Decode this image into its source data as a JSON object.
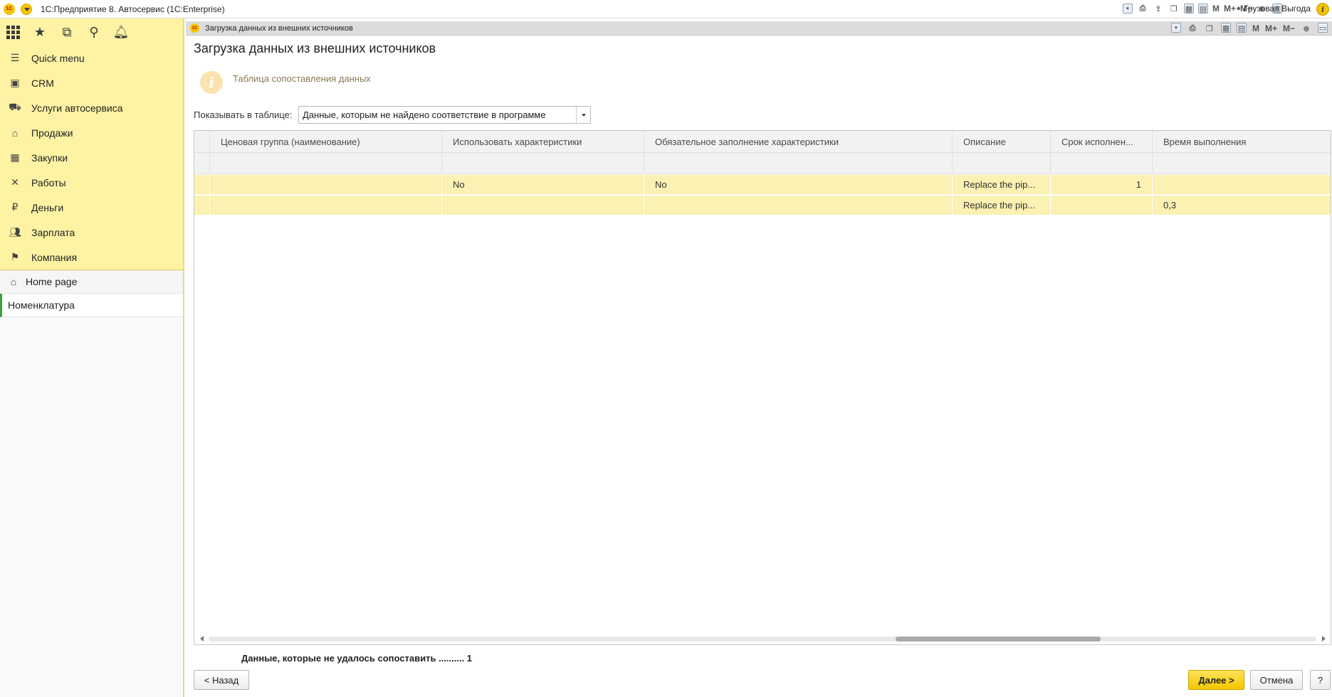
{
  "titlebar": {
    "logo": "1С",
    "app_title": "1С:Предприятие 8. Автосервис  (1C:Enterprise)",
    "tools": [
      "save-icon",
      "print-icon",
      "upload-icon",
      "copy-icon",
      "calculator-icon",
      "calendar-icon"
    ],
    "memory": {
      "m": "M",
      "m_plus": "M+",
      "m_minus": "M−"
    },
    "user": "Грузовая Выгода"
  },
  "sidebar": {
    "items": [
      {
        "label": "Quick menu",
        "icon": "menu-icon"
      },
      {
        "label": "CRM",
        "icon": "crm-icon"
      },
      {
        "label": "Услуги автосервиса",
        "icon": "car-icon"
      },
      {
        "label": "Продажи",
        "icon": "shop-icon"
      },
      {
        "label": "Закупки",
        "icon": "cart-icon"
      },
      {
        "label": "Работы",
        "icon": "tools-icon"
      },
      {
        "label": "Деньги",
        "icon": "ruble-icon"
      },
      {
        "label": "Зарплата",
        "icon": "people-icon"
      },
      {
        "label": "Компания",
        "icon": "flag-icon"
      }
    ],
    "home": "Home page",
    "open_windows": [
      "Номенклатура"
    ]
  },
  "window": {
    "tab_title": "Загрузка данных из внешних источников",
    "memory": {
      "m": "M",
      "m_plus": "M+",
      "m_minus": "M−"
    }
  },
  "form": {
    "title": "Загрузка данных из внешних источников",
    "info_text": "Таблица сопоставления данных",
    "show_label": "Показывать в таблице:",
    "show_value": "Данные, которым не найдено соответствие в программе"
  },
  "table": {
    "columns": [
      "Ценовая группа (наименование)",
      "Использовать характеристики",
      "Обязательное заполнение характеристики",
      "Описание",
      "Срок исполнен...",
      "Время выполнения"
    ],
    "rows": [
      [
        "",
        "No",
        "No",
        "Replace the pip...",
        "1",
        ""
      ],
      [
        "",
        "",
        "",
        "Replace the pip...",
        "",
        "0,3"
      ]
    ]
  },
  "summary": "Данные, которые не удалось сопоставить .......... 1",
  "buttons": {
    "back": "< Назад",
    "next": "Далее >",
    "cancel": "Отмена",
    "help": "?"
  },
  "colors": {
    "sidebar_bg": "#fdf3a3",
    "row_highlight": "#faf1b2",
    "primary_button": "#f4c600"
  }
}
